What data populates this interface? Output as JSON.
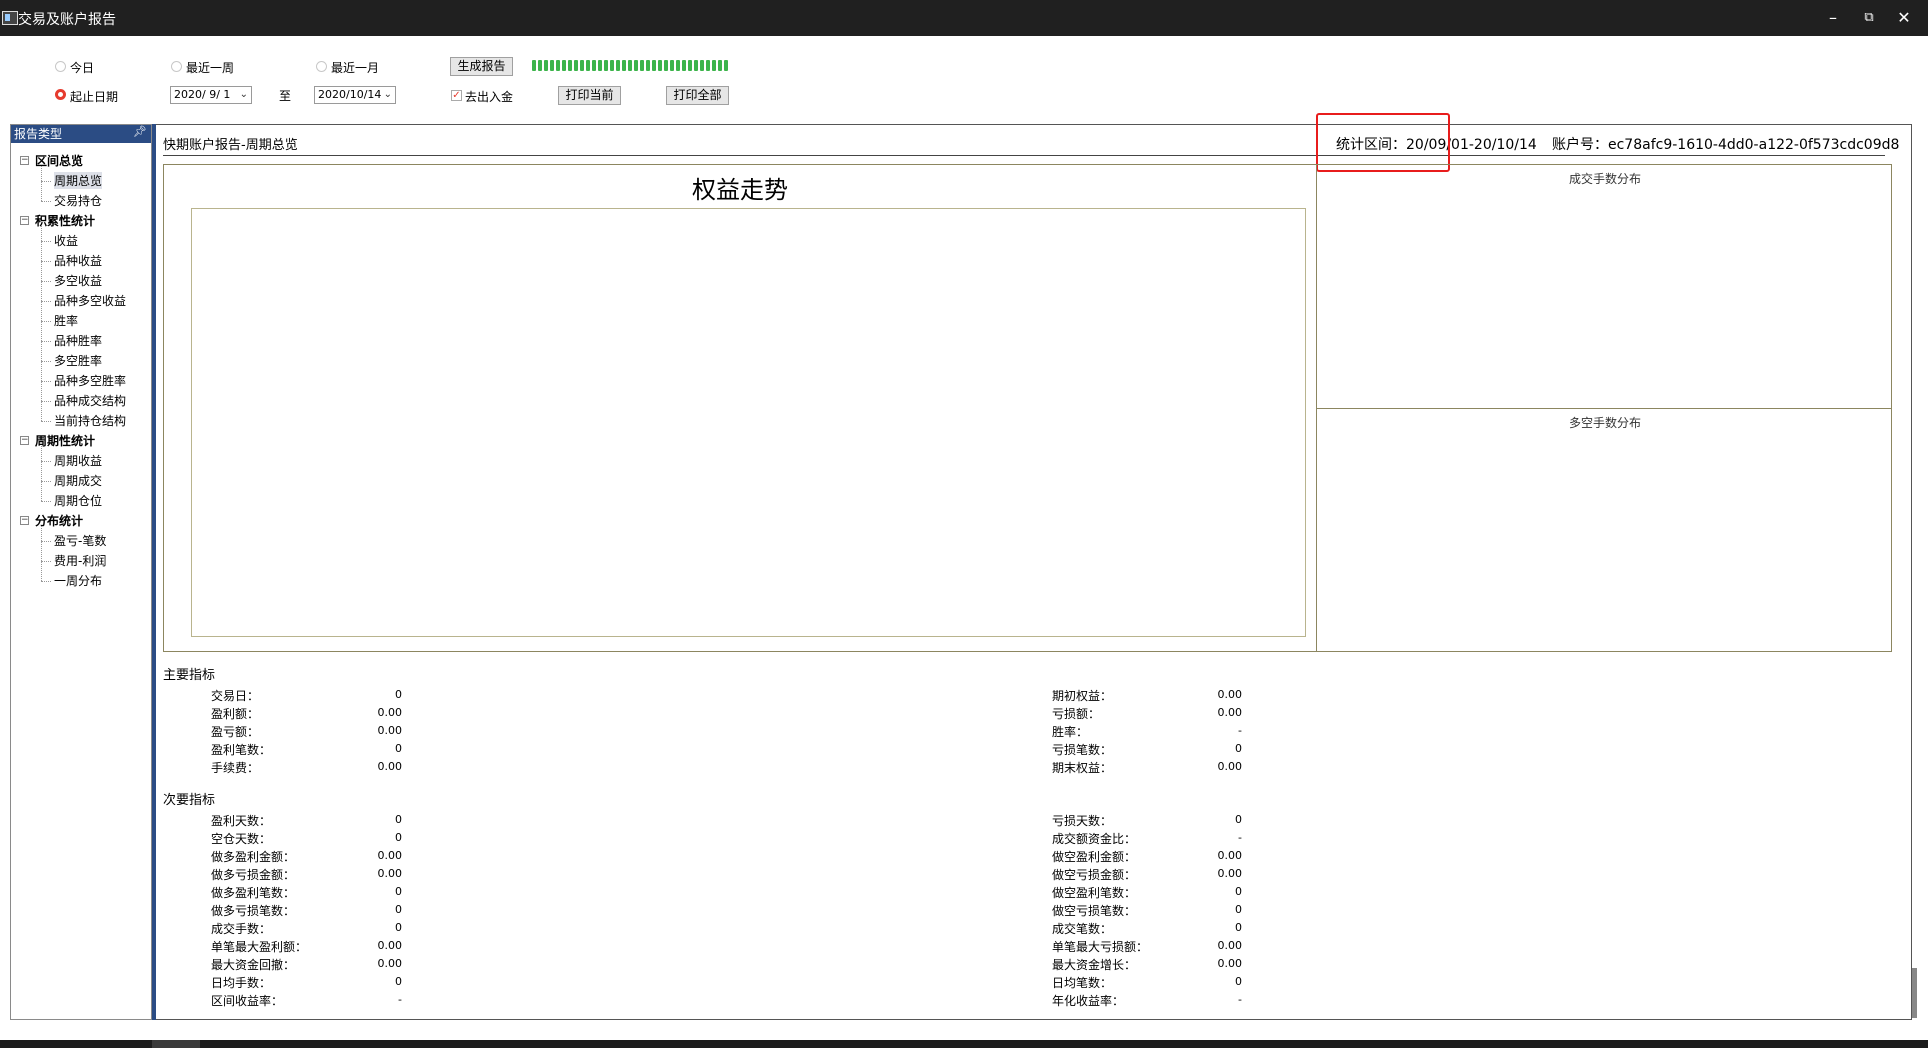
{
  "window": {
    "title": "交易及账户报告",
    "controls": [
      "minimize",
      "restore",
      "close"
    ]
  },
  "toolbar": {
    "range_today": "今日",
    "range_week": "最近一周",
    "range_month": "最近一月",
    "range_custom": "起止日期",
    "selected_range": "起止日期",
    "date_from": "2020/ 9/ 1",
    "to_label": "至",
    "date_to": "2020/10/14",
    "generate_button": "生成报告",
    "exclude_deposit_label": "去出入金",
    "exclude_deposit_checked": true,
    "print_current_button": "打印当前",
    "print_all_button": "打印全部",
    "progress": 1.0,
    "progress_color": "#3cb44b"
  },
  "sidebar": {
    "header": "报告类型",
    "groups": [
      {
        "label": "区间总览",
        "items": [
          "周期总览",
          "交易持仓"
        ]
      },
      {
        "label": "积累性统计",
        "items": [
          "收益",
          "品种收益",
          "多空收益",
          "品种多空收益",
          "胜率",
          "品种胜率",
          "多空胜率",
          "品种多空胜率",
          "品种成交结构",
          "当前持仓结构"
        ]
      },
      {
        "label": "周期性统计",
        "items": [
          "周期收益",
          "周期成交",
          "周期仓位"
        ]
      },
      {
        "label": "分布统计",
        "items": [
          "盈亏-笔数",
          "费用-利润",
          "一周分布"
        ]
      }
    ],
    "selected": "周期总览"
  },
  "report": {
    "heading": "快期账户报告-周期总览",
    "period": "统计区间：20/09/01-20/10/14",
    "account": "账户号：ec78afc9-1610-4dd0-a122-0f573cdc09d8"
  },
  "charts": {
    "equity_title": "权益走势",
    "trade_lots_title": "成交手数分布",
    "long_short_title": "多空手数分布"
  },
  "metrics": {
    "main_title": "主要指标",
    "main_left": [
      {
        "label": "交易日：",
        "value": "0"
      },
      {
        "label": "盈利额：",
        "value": "0.00"
      },
      {
        "label": "盈亏额：",
        "value": "0.00"
      },
      {
        "label": "盈利笔数：",
        "value": "0"
      },
      {
        "label": "手续费：",
        "value": "0.00"
      }
    ],
    "main_right": [
      {
        "label": "期初权益：",
        "value": "0.00"
      },
      {
        "label": "亏损额：",
        "value": "0.00"
      },
      {
        "label": "胜率：",
        "value": "-"
      },
      {
        "label": "亏损笔数：",
        "value": "0"
      },
      {
        "label": "期末权益：",
        "value": "0.00"
      }
    ],
    "sub_title": "次要指标",
    "sub_left": [
      {
        "label": "盈利天数：",
        "value": "0"
      },
      {
        "label": "空仓天数：",
        "value": "0"
      },
      {
        "label": "做多盈利金额：",
        "value": "0.00"
      },
      {
        "label": "做多亏损金额：",
        "value": "0.00"
      },
      {
        "label": "做多盈利笔数：",
        "value": "0"
      },
      {
        "label": "做多亏损笔数：",
        "value": "0"
      },
      {
        "label": "成交手数：",
        "value": "0"
      },
      {
        "label": "单笔最大盈利额：",
        "value": "0.00"
      },
      {
        "label": "最大资金回撤：",
        "value": "0.00"
      },
      {
        "label": "日均手数：",
        "value": "0"
      },
      {
        "label": "区间收益率：",
        "value": "-"
      }
    ],
    "sub_right": [
      {
        "label": "亏损天数：",
        "value": "0"
      },
      {
        "label": "成交额资金比：",
        "value": "-"
      },
      {
        "label": "做空盈利金额：",
        "value": "0.00"
      },
      {
        "label": "做空亏损金额：",
        "value": "0.00"
      },
      {
        "label": "做空盈利笔数：",
        "value": "0"
      },
      {
        "label": "做空亏损笔数：",
        "value": "0"
      },
      {
        "label": "成交笔数：",
        "value": "0"
      },
      {
        "label": "单笔最大亏损额：",
        "value": "0.00"
      },
      {
        "label": "最大资金增长：",
        "value": "0.00"
      },
      {
        "label": "日均笔数：",
        "value": "0"
      },
      {
        "label": "年化收益率：",
        "value": "-"
      }
    ]
  },
  "colors": {
    "sidebar_header": "#2b4c84",
    "highlight": "#e81c1c",
    "radio_on": "#e63b2e"
  }
}
